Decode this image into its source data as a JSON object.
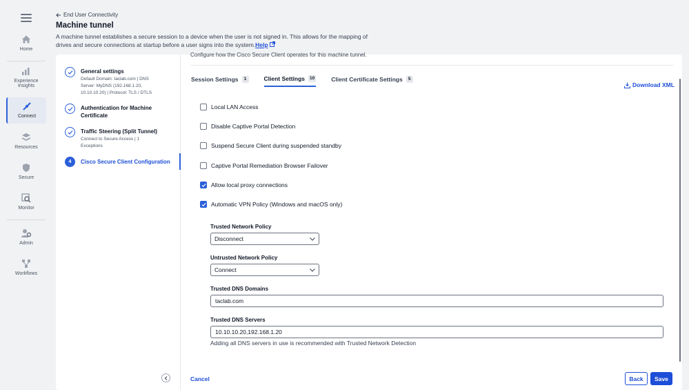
{
  "nav": {
    "items": [
      {
        "label": "Home",
        "icon": "home-icon"
      },
      {
        "label": "Experience Insights",
        "icon": "insights-icon"
      },
      {
        "label": "Connect",
        "icon": "connect-icon"
      },
      {
        "label": "Resources",
        "icon": "resources-icon"
      },
      {
        "label": "Secure",
        "icon": "shield-icon"
      },
      {
        "label": "Monitor",
        "icon": "monitor-icon"
      },
      {
        "label": "Admin",
        "icon": "admin-icon"
      },
      {
        "label": "Workflows",
        "icon": "workflows-icon"
      }
    ],
    "active": "Connect"
  },
  "header": {
    "back_label": "End User Connectivity",
    "title": "Machine tunnel",
    "description": "A machine tunnel establishes a secure session to a device when the user is not signed in. This allows for the mapping of drives and secure connections at startup before a user signs into the system.",
    "help_label": "Help"
  },
  "steps": [
    {
      "title": "General settings",
      "sub": "Default Domain: taclab.com | DNS Server: MyDNS (192.168.1.20, 10.10.10.20) | Protocol: TLS / DTLS",
      "state": "done"
    },
    {
      "title": "Authentication for Machine Certificate",
      "sub": "",
      "state": "done"
    },
    {
      "title": "Traffic Steering (Split Tunnel)",
      "sub": "Connect to Secure Access | 1 Exceptions",
      "state": "done"
    },
    {
      "title": "Cisco Secure Client Configuration",
      "sub": "",
      "state": "current",
      "number": "4"
    }
  ],
  "main": {
    "intro": "Configure how the Cisco Secure Client operates for this machine tunnel.",
    "tabs": [
      {
        "label": "Session Settings",
        "badge": "1"
      },
      {
        "label": "Client Settings",
        "badge": "10"
      },
      {
        "label": "Client Certificate Settings",
        "badge": "5"
      }
    ],
    "active_tab": "Client Settings",
    "download_label": "Download XML",
    "checkboxes": [
      {
        "label": "Local LAN Access",
        "checked": false
      },
      {
        "label": "Disable Captive Portal Detection",
        "checked": false
      },
      {
        "label": "Suspend Secure Client during suspended standby",
        "checked": false
      },
      {
        "label": "Captive Portal Remediation Browser Failover",
        "checked": false
      },
      {
        "label": "Allow local proxy connections",
        "checked": true
      },
      {
        "label": "Automatic VPN Policy (Windows and macOS only)",
        "checked": true
      }
    ],
    "trusted_network_policy": {
      "label": "Trusted Network Policy",
      "value": "Disconnect"
    },
    "untrusted_network_policy": {
      "label": "Untrusted Network Policy",
      "value": "Connect"
    },
    "trusted_dns_domains": {
      "label": "Trusted DNS Domains",
      "value": "taclab.com"
    },
    "trusted_dns_servers": {
      "label": "Trusted DNS Servers",
      "value": "10.10.10.20,192.168.1.20",
      "hint": "Adding all DNS servers in use is recommended with Trusted Network Detection"
    }
  },
  "footer": {
    "cancel_label": "Cancel",
    "back_label": "Back",
    "save_label": "Save"
  },
  "colors": {
    "accent": "#1d4ed8",
    "nav_bg": "#f1f2f4"
  }
}
